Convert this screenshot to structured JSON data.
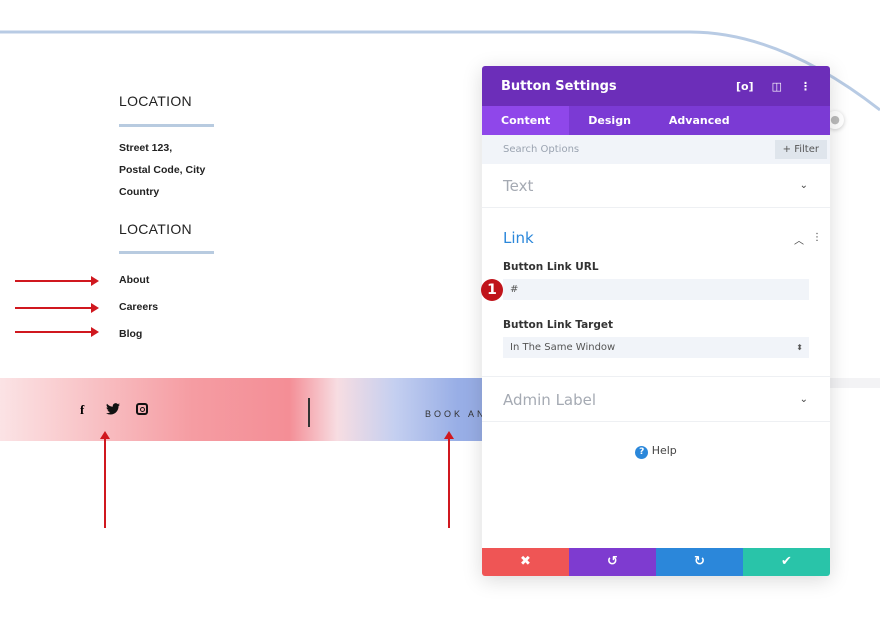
{
  "left": {
    "heading1": "LOCATION",
    "address": [
      "Street 123,",
      "Postal Code, City",
      "Country"
    ],
    "heading2": "LOCATION",
    "links": [
      "About",
      "Careers",
      "Blog"
    ]
  },
  "footer": {
    "social_icons": [
      "facebook-icon",
      "twitter-icon",
      "instagram-icon"
    ],
    "social": [
      "f"
    ],
    "cta": "BOOK AN"
  },
  "panel": {
    "title": "Button Settings",
    "tabs": [
      "Content",
      "Design",
      "Advanced"
    ],
    "search_placeholder": "Search Options",
    "filter": "+ Filter",
    "sections": {
      "text": "Text",
      "link": "Link",
      "admin": "Admin Label"
    },
    "url_label": "Button Link URL",
    "url_value": "#",
    "target_label": "Button Link Target",
    "target_value": "In The Same Window",
    "help": "Help",
    "badge": "1"
  },
  "colors": {
    "header": "#6c2eb9",
    "tabs": "#7b3ad4",
    "cancel": "#ef5555",
    "undo": "#7e3bd0",
    "redo": "#2b87da",
    "save": "#29c4a9",
    "arrow": "#d0181f"
  }
}
